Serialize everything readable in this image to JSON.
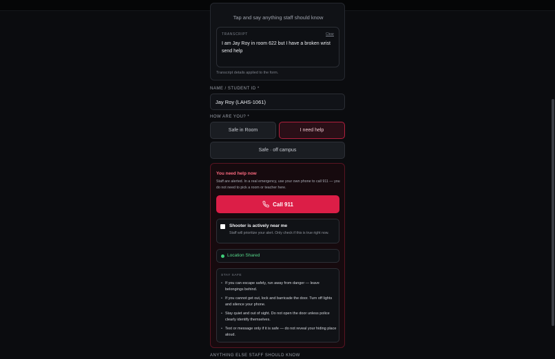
{
  "voice": {
    "hint": "Tap and say anything staff should know",
    "transcript_label": "TRANSCRIPT",
    "clear_label": "Clear",
    "transcript_text": "I am Jay Roy in room 622 but I have a broken wrist send help",
    "note": "Transcript details applied to the form."
  },
  "form": {
    "name_label": "NAME / STUDENT ID *",
    "name_value": "Jay Roy (LAHS-1061)",
    "status_label": "HOW ARE YOU? *",
    "options": [
      {
        "label": "Safe in Room",
        "selected": false
      },
      {
        "label": "I need help",
        "selected": true
      },
      {
        "label": "Safe · off campus",
        "selected": false
      }
    ],
    "bottom_label": "ANYTHING ELSE STAFF SHOULD KNOW"
  },
  "help": {
    "title": "You need help now",
    "description": "Staff are alerted. In a real emergency, use your own phone to call 911 — you do not need to pick a room or teacher here.",
    "call_label": "Call 911",
    "call_icon": "phone-icon",
    "shooter_title": "Shooter is actively near me",
    "shooter_desc": "Staff will prioritize your alert. Only check if this is true right now.",
    "location_text": "Location Shared",
    "safe_label": "STAY SAFE",
    "tips": [
      "If you can escape safely, run away from danger — leave belongings behind.",
      "If you cannot get out, lock and barricade the door. Turn off lights and silence your phone.",
      "Stay quiet and out of sight. Do not open the door unless police clearly identify themselves.",
      "Text or message only if it is safe — do not reveal your hiding place aloud."
    ]
  },
  "colors": {
    "accent_danger": "#dc1e47",
    "success": "#3fcf7a",
    "background": "#0b0c0f"
  }
}
